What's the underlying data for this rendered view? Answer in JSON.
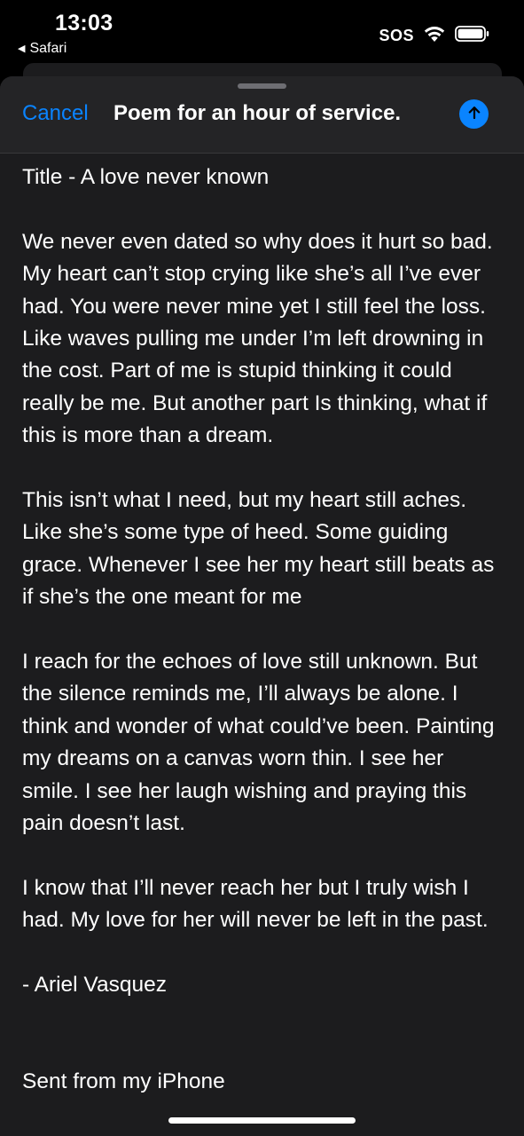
{
  "status_bar": {
    "time": "13:03",
    "back_app": "Safari",
    "sos": "SOS",
    "icons": [
      "back-arrow-icon",
      "wifi-icon",
      "battery-icon"
    ]
  },
  "compose": {
    "cancel_label": "Cancel",
    "subject": "Poem for an hour of service.",
    "send_icon": "arrow-up-icon",
    "accent_color": "#0a84ff"
  },
  "body": {
    "paragraphs": [
      "Title - A love never known",
      "We never even dated so why does it hurt so bad. My heart can’t stop crying like she’s all I’ve ever had. You were never mine yet I still feel the loss. Like waves pulling me under I’m left drowning in the cost. Part of me is stupid thinking it could really be me. But another part Is thinking, what if this is more than a dream.",
      "This isn’t what I need, but my heart still aches. Like she’s some type of heed. Some guiding grace. Whenever I see her my heart still beats as if she’s the one meant for me",
      "I reach for the echoes of love still unknown. But the silence reminds me, I’ll always be alone. I think and wonder of what could’ve been. Painting my dreams on a canvas worn thin. I see her smile. I see her laugh wishing and praying this pain doesn’t last.",
      "I know that I’ll never reach her but I truly wish I had. My love for her will never be left in the past.",
      "- Ariel Vasquez"
    ],
    "signature": "Sent from my iPhone"
  }
}
